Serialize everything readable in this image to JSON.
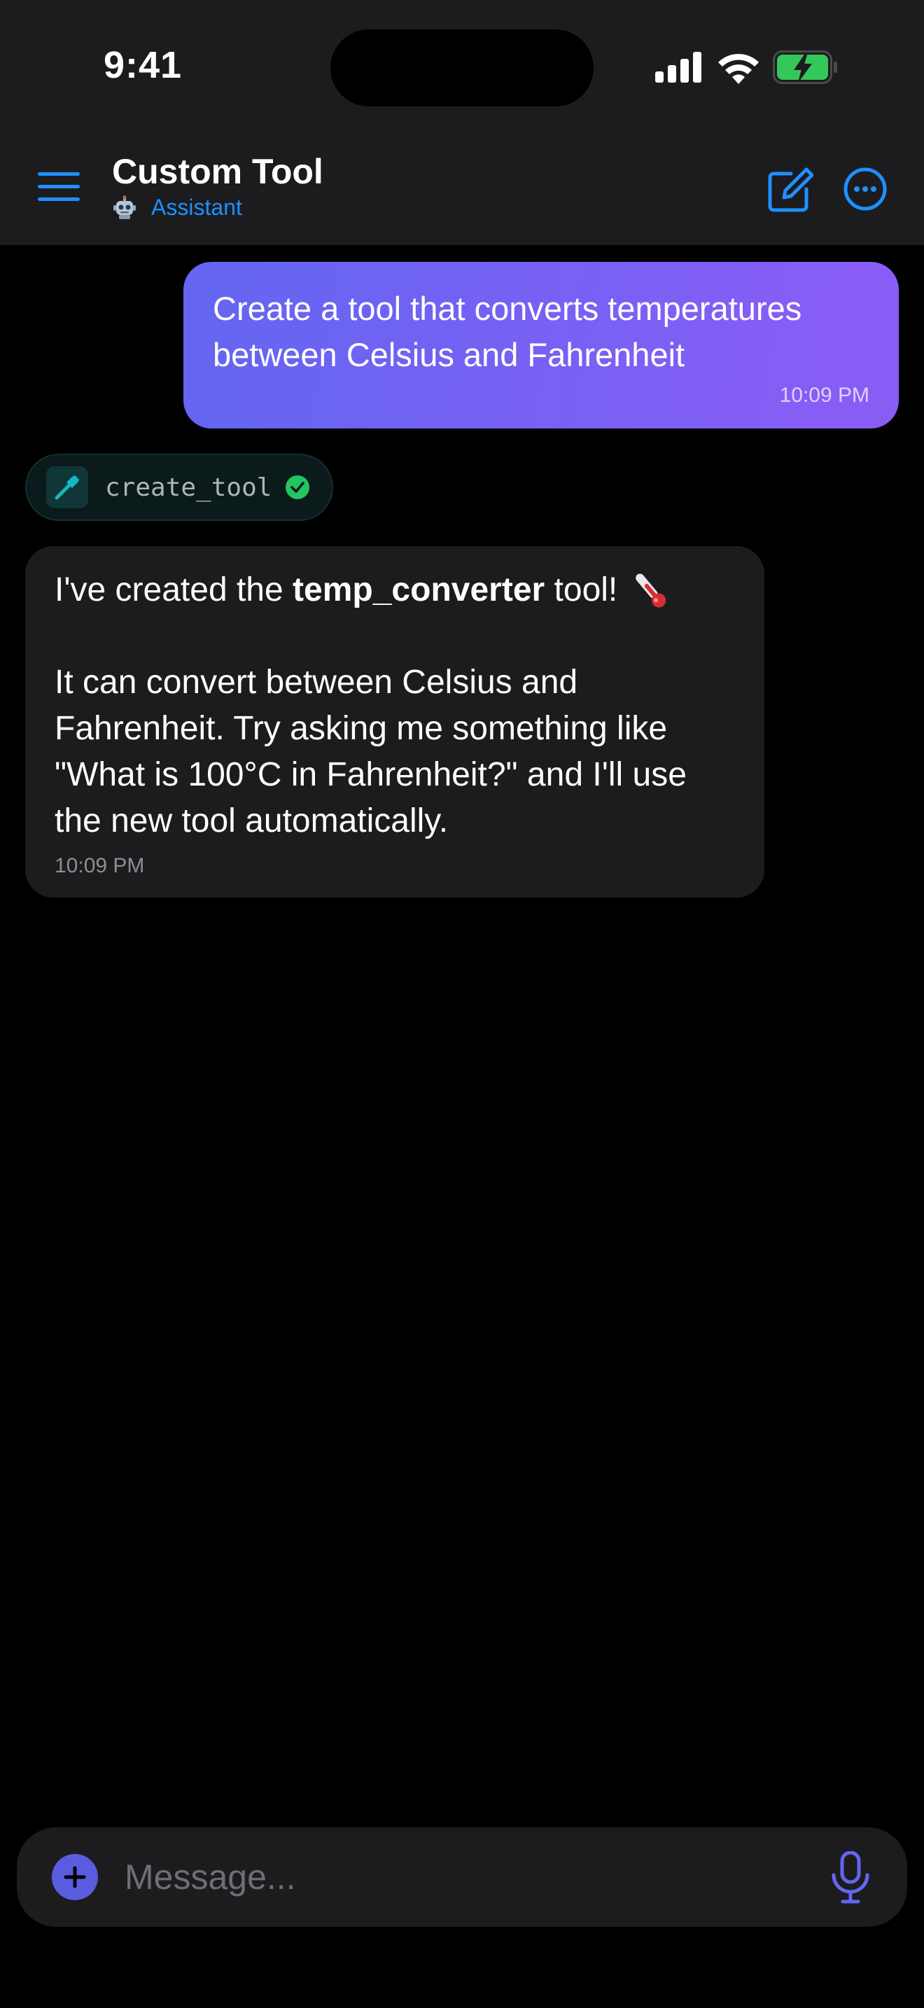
{
  "status_bar": {
    "time": "9:41"
  },
  "header": {
    "title": "Custom Tool",
    "subtitle": "Assistant",
    "subtitle_icon": "robot-icon"
  },
  "messages": {
    "user": {
      "text": "Create a tool that converts temperatures between Celsius and Fahrenheit",
      "time": "10:09 PM"
    },
    "tool_call": {
      "name": "create_tool",
      "status": "success",
      "icon": "hammer-icon"
    },
    "assistant": {
      "intro_before": "I've created the",
      "intro_bold": "temp_converter",
      "intro_after": "tool!",
      "emoji": "thermometer-icon",
      "body": "It can convert between Celsius and Fahrenheit. Try asking me something like \"What is 100°C in Fahrenheit?\" and I'll use the new tool automatically.",
      "time": "10:09 PM"
    }
  },
  "composer": {
    "placeholder": "Message..."
  },
  "colors": {
    "accent": "#1e90ff",
    "user_bubble_start": "#6366f1",
    "user_bubble_end": "#8b5cf6",
    "success": "#22c55e",
    "tool_teal": "#14b8c4"
  }
}
